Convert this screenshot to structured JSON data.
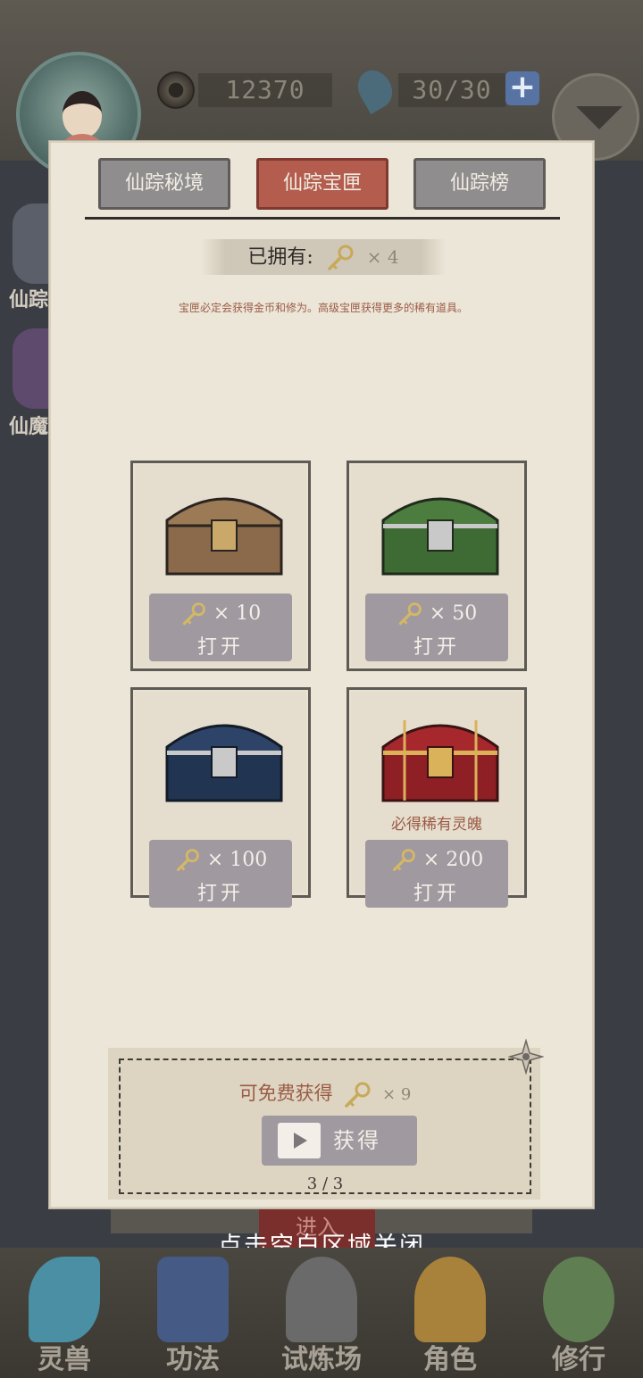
{
  "hud": {
    "coins": "12370",
    "stamina": "30/30",
    "plus_icon": "+"
  },
  "side_menu": [
    {
      "label": "仙踪",
      "icon": "side-scene-icon"
    },
    {
      "label": "仙魔",
      "icon": "side-demon-icon"
    }
  ],
  "behind_button": "进入",
  "close_hint": "点击空白区域关闭",
  "bottom_nav": [
    {
      "label": "灵兽",
      "color": "#4a8fa4"
    },
    {
      "label": "功法",
      "color": "#465a86"
    },
    {
      "label": "试炼场",
      "color": "#6a6a6a"
    },
    {
      "label": "角色",
      "color": "#a8823a"
    },
    {
      "label": "修行",
      "color": "#5f7f52"
    }
  ],
  "modal": {
    "tabs": [
      {
        "label": "仙踪秘境",
        "active": false
      },
      {
        "label": "仙踪宝匣",
        "active": true
      },
      {
        "label": "仙踪榜",
        "active": false
      }
    ],
    "owned_label": "已拥有:",
    "owned_count": "× 4",
    "description": "宝匣必定会获得金币和修为。高级宝匣获得更多的稀有道具。",
    "chests": [
      {
        "name": "wooden-chest",
        "cost": "× 10",
        "button": "打开",
        "note": "",
        "body": "#8a6a4a",
        "lid": "#9b7a55",
        "trim": "#c9a86a"
      },
      {
        "name": "green-chest",
        "cost": "× 50",
        "button": "打开",
        "note": "",
        "body": "#3e6b34",
        "lid": "#4c7d3f",
        "trim": "#c9c9c9"
      },
      {
        "name": "blue-chest",
        "cost": "× 100",
        "button": "打开",
        "note": "",
        "body": "#213552",
        "lid": "#2d4468",
        "trim": "#c9c9c9"
      },
      {
        "name": "red-chest",
        "cost": "× 200",
        "button": "打开",
        "note": "必得稀有灵魄",
        "body": "#8e1f24",
        "lid": "#a6282d",
        "trim": "#d9b25a"
      }
    ],
    "free": {
      "label": "可免费获得",
      "count": "× 9",
      "button": "获得",
      "progress": "3 / 3"
    }
  },
  "colors": {
    "panel": "#ece6d8",
    "tab_active": "#b45d4e",
    "tab_inactive": "#8f8d8e",
    "button": "#a09aa0",
    "accent_text": "#9b5b46",
    "key": "#c8a95a"
  }
}
